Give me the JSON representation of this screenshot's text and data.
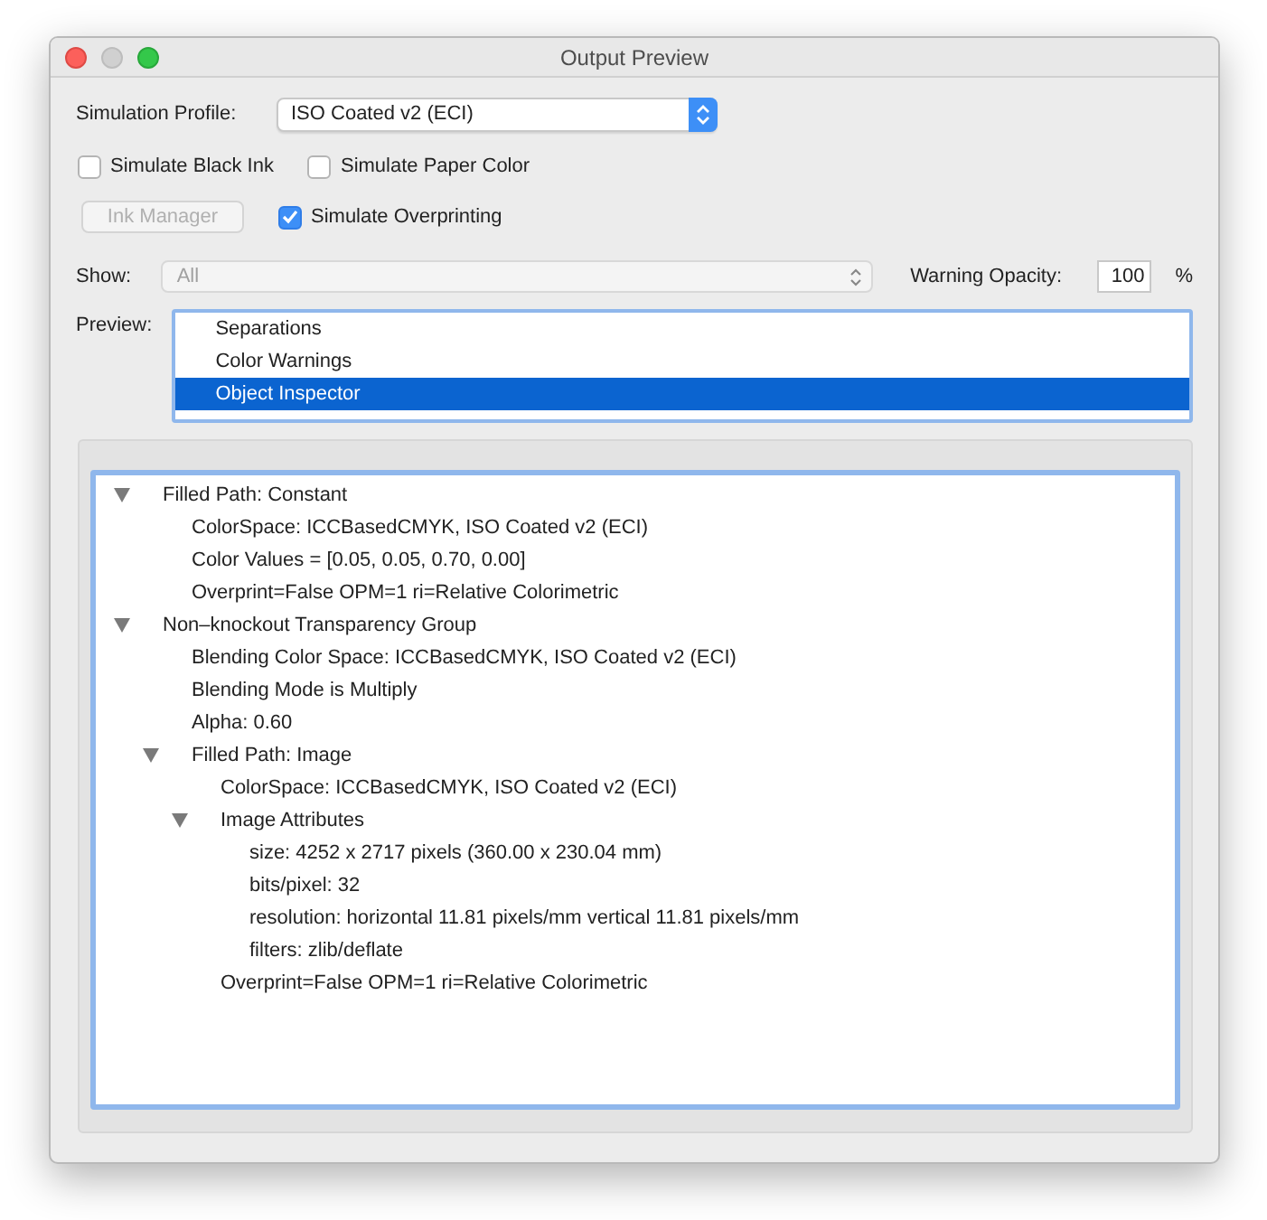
{
  "window": {
    "title": "Output Preview"
  },
  "simulation_profile": {
    "label": "Simulation Profile:",
    "value": "ISO Coated v2 (ECI)"
  },
  "checkboxes": [
    {
      "label": "Simulate Black Ink",
      "checked": false
    },
    {
      "label": "Simulate Paper Color",
      "checked": false
    }
  ],
  "ink_manager": {
    "label": "Ink Manager",
    "disabled": true
  },
  "simulate_overprinting": {
    "label": "Simulate Overprinting",
    "checked": true
  },
  "show": {
    "label": "Show:",
    "value": "All",
    "disabled": true
  },
  "warning_opacity": {
    "label": "Warning Opacity:",
    "value": "100",
    "unit": "%"
  },
  "preview": {
    "label": "Preview:",
    "items": [
      {
        "label": "Separations",
        "selected": false
      },
      {
        "label": "Color Warnings",
        "selected": false
      },
      {
        "label": "Object Inspector",
        "selected": true
      }
    ]
  },
  "tree": [
    {
      "label": "Filled Path: Constant",
      "expanded": true,
      "children": [
        {
          "label": "ColorSpace: ICCBasedCMYK, ISO Coated v2 (ECI)"
        },
        {
          "label": "Color Values = [0.05, 0.05, 0.70, 0.00]"
        },
        {
          "label": "Overprint=False OPM=1 ri=Relative Colorimetric"
        }
      ]
    },
    {
      "label": "Non–knockout Transparency Group",
      "expanded": true,
      "children": [
        {
          "label": "Blending Color Space: ICCBasedCMYK, ISO Coated v2 (ECI)"
        },
        {
          "label": "Blending Mode is Multiply"
        },
        {
          "label": "Alpha: 0.60"
        },
        {
          "label": "Filled Path: Image",
          "expanded": true,
          "children": [
            {
              "label": "ColorSpace: ICCBasedCMYK, ISO Coated v2 (ECI)"
            },
            {
              "label": "Image Attributes",
              "expanded": true,
              "children": [
                {
                  "label": "size: 4252 x 2717 pixels (360.00 x 230.04 mm)"
                },
                {
                  "label": "bits/pixel: 32"
                },
                {
                  "label": "resolution: horizontal 11.81 pixels/mm vertical 11.81 pixels/mm"
                },
                {
                  "label": "filters: zlib/deflate"
                }
              ]
            },
            {
              "label": "Overprint=False OPM=1 ri=Relative Colorimetric"
            }
          ]
        }
      ]
    }
  ]
}
